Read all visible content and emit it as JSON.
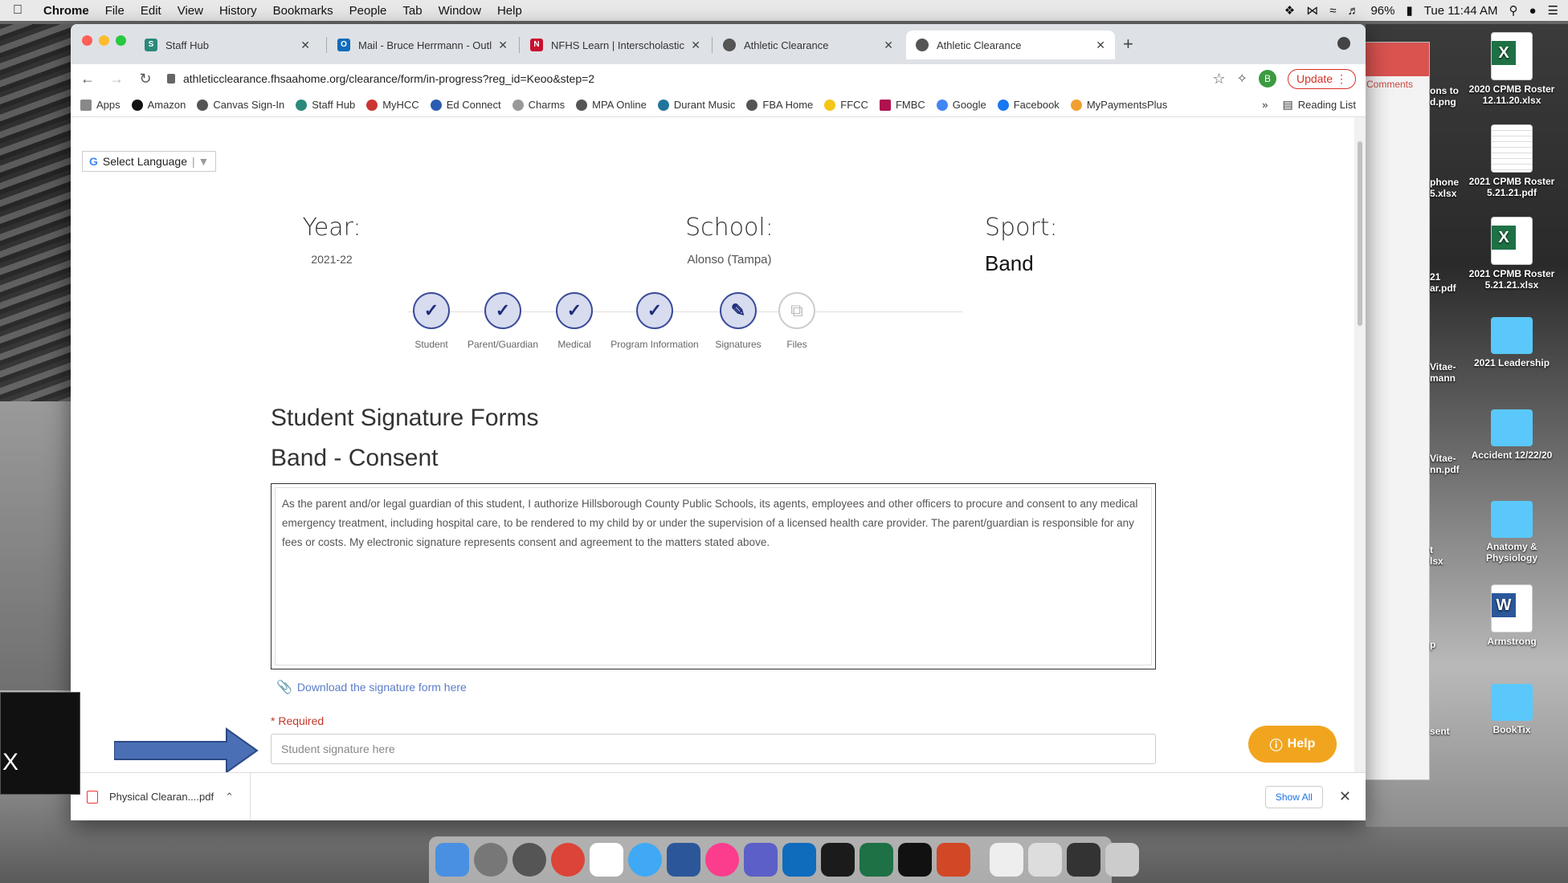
{
  "menubar": {
    "app": "Chrome",
    "items": [
      "File",
      "Edit",
      "View",
      "History",
      "Bookmarks",
      "People",
      "Tab",
      "Window",
      "Help"
    ],
    "battery": "96%",
    "clock": "Tue 11:44 AM"
  },
  "tabs": [
    {
      "title": "Staff Hub",
      "color": "#2a8a7a",
      "letter": "S"
    },
    {
      "title": "Mail - Bruce Herrmann - Outlo",
      "color": "#0f6cbd",
      "letter": "O"
    },
    {
      "title": "NFHS Learn | Interscholastic E",
      "color": "#c8102e",
      "letter": "N"
    },
    {
      "title": "Athletic Clearance",
      "color": "#555555",
      "letter": ""
    },
    {
      "title": "Athletic Clearance",
      "color": "#555555",
      "letter": ""
    }
  ],
  "address": {
    "url": "athleticclearance.fhsaahome.org/clearance/form/in-progress?reg_id=Keoo&step=2",
    "profile_letter": "B",
    "update_label": "Update"
  },
  "bookmarks": {
    "items": [
      "Apps",
      "Amazon",
      "Canvas Sign-In",
      "Staff Hub",
      "MyHCC",
      "Ed Connect",
      "Charms",
      "MPA Online",
      "Durant Music",
      "FBA Home",
      "FFCC",
      "FMBC",
      "Google",
      "Facebook",
      "MyPaymentsPlus"
    ],
    "more": "»",
    "reading_list": "Reading List"
  },
  "page": {
    "select_language": "Select Language",
    "year_label": "Year:",
    "year_value": "2021-22",
    "school_label": "School:",
    "school_value": "Alonso (Tampa)",
    "sport_label": "Sport:",
    "sport_value": "Band",
    "steps": [
      {
        "label": "Student",
        "done": true
      },
      {
        "label": "Parent/Guardian",
        "done": true
      },
      {
        "label": "Medical",
        "done": true
      },
      {
        "label": "Program Information",
        "done": true
      },
      {
        "label": "Signatures",
        "done": true
      },
      {
        "label": "Files",
        "done": false
      }
    ],
    "section_title": "Student Signature Forms",
    "form_title": "Band - Consent",
    "consent_text": "As the parent and/or legal guardian of this student, I authorize Hillsborough County Public Schools, its agents, employees and other officers to procure and consent to any medical emergency treatment, including hospital care, to be rendered to my child by or under the supervision of a licensed health care provider.  The parent/guardian is responsible for any fees or costs. My electronic signature represents consent and agreement to the matters stated above.",
    "download_link": "Download the signature form here",
    "required_label": "* Required",
    "signature_placeholder": "Student signature here",
    "help_label": "Help"
  },
  "downloads": {
    "file": "Physical Clearan....pdf",
    "show_all": "Show All"
  },
  "desktop": {
    "icons": [
      {
        "label": "2020 CPMB Roster 12.11.20.xlsx",
        "kind": "xl"
      },
      {
        "label": "2021 CPMB Roster 5.21.21.pdf",
        "kind": "pdf"
      },
      {
        "label": "2021 CPMB Roster 5.21.21.xlsx",
        "kind": "xl"
      },
      {
        "label": "2021 Leadership",
        "kind": "folder"
      },
      {
        "label": "Accident 12/22/20",
        "kind": "folder"
      },
      {
        "label": "Anatomy & Physiology",
        "kind": "folder"
      },
      {
        "label": "Armstrong",
        "kind": "wd"
      },
      {
        "label": "BookTix",
        "kind": "folder"
      }
    ],
    "partial_labels": [
      "ons to",
      "d.png",
      "phone",
      "5.xlsx",
      "21",
      "ar.pdf",
      "Vitae-",
      "mann",
      "Vitae-",
      "nn.pdf",
      "t",
      "lsx",
      "p",
      "sent"
    ],
    "back_window_comments": "Comments",
    "black_box_text": "X"
  }
}
